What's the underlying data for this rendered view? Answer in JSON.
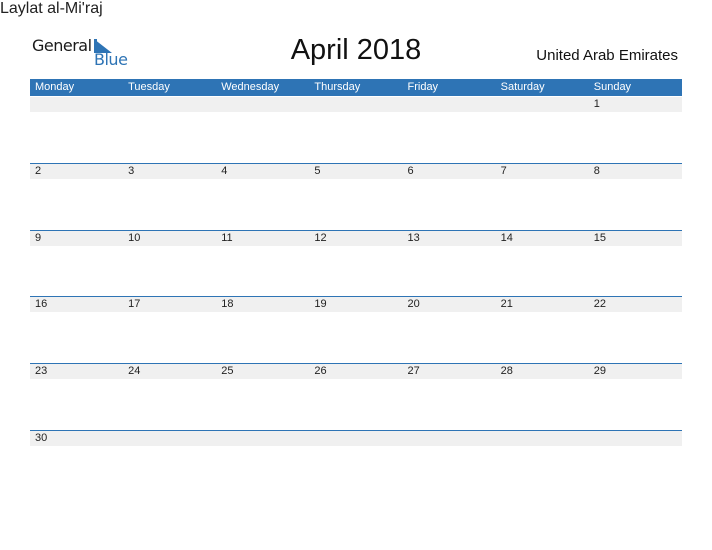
{
  "logo": {
    "general": "General",
    "blue": "Blue",
    "icon": "triangle-flag-icon",
    "accent": "#2e74b5"
  },
  "title": "April 2018",
  "country": "United Arab Emirates",
  "header_color": "#2e74b5",
  "days": [
    "Monday",
    "Tuesday",
    "Wednesday",
    "Thursday",
    "Friday",
    "Saturday",
    "Sunday"
  ],
  "weeks": [
    [
      "",
      "",
      "",
      "",
      "",
      "",
      "1"
    ],
    [
      "2",
      "3",
      "4",
      "5",
      "6",
      "7",
      "8"
    ],
    [
      "9",
      "10",
      "11",
      "12",
      "13",
      "14",
      "15"
    ],
    [
      "16",
      "17",
      "18",
      "19",
      "20",
      "21",
      "22"
    ],
    [
      "23",
      "24",
      "25",
      "26",
      "27",
      "28",
      "29"
    ],
    [
      "30",
      "",
      "",
      "",
      "",
      "",
      ""
    ]
  ],
  "holidays": [
    {
      "week": 2,
      "day": 4,
      "date": "13",
      "name": "Laylat al-Mi'raj"
    }
  ]
}
